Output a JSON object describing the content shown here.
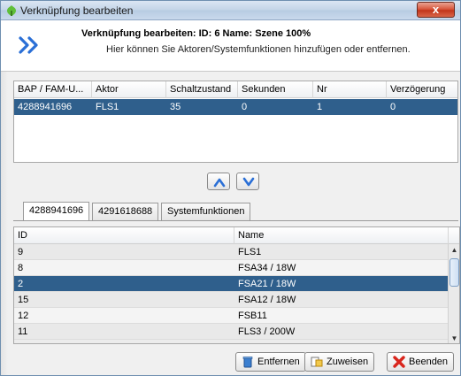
{
  "window": {
    "title": "Verknüpfung bearbeiten",
    "close_label": "x"
  },
  "header": {
    "title": "Verknüpfung bearbeiten: ID: 6 Name: Szene 100%",
    "subtitle": "Hier können Sie Aktoren/Systemfunktionen hinzufügen oder entfernen."
  },
  "links_table": {
    "columns": [
      "BAP / FAM-U...",
      "Aktor",
      "Schaltzustand",
      "Sekunden",
      "Nr",
      "Verzögerung"
    ],
    "rows": [
      [
        "4288941696",
        "FLS1",
        "35",
        "0",
        "1",
        "0"
      ]
    ]
  },
  "tabs": [
    "4288941696",
    "4291618688",
    "Systemfunktionen"
  ],
  "active_tab": "4288941696",
  "devices_table": {
    "columns": [
      "ID",
      "Name"
    ],
    "rows": [
      [
        "9",
        "FLS1"
      ],
      [
        "8",
        "FSA34 / 18W"
      ],
      [
        "2",
        "FSA21 / 18W"
      ],
      [
        "15",
        "FSA12 / 18W"
      ],
      [
        "12",
        "FSB11"
      ],
      [
        "11",
        "FLS3 / 200W"
      ]
    ],
    "selected_index": 2
  },
  "buttons": {
    "remove": "Entfernen",
    "assign": "Zuweisen",
    "quit": "Beenden"
  },
  "colors": {
    "selection": "#2f5f8c",
    "accent": "#2a6fd6"
  }
}
